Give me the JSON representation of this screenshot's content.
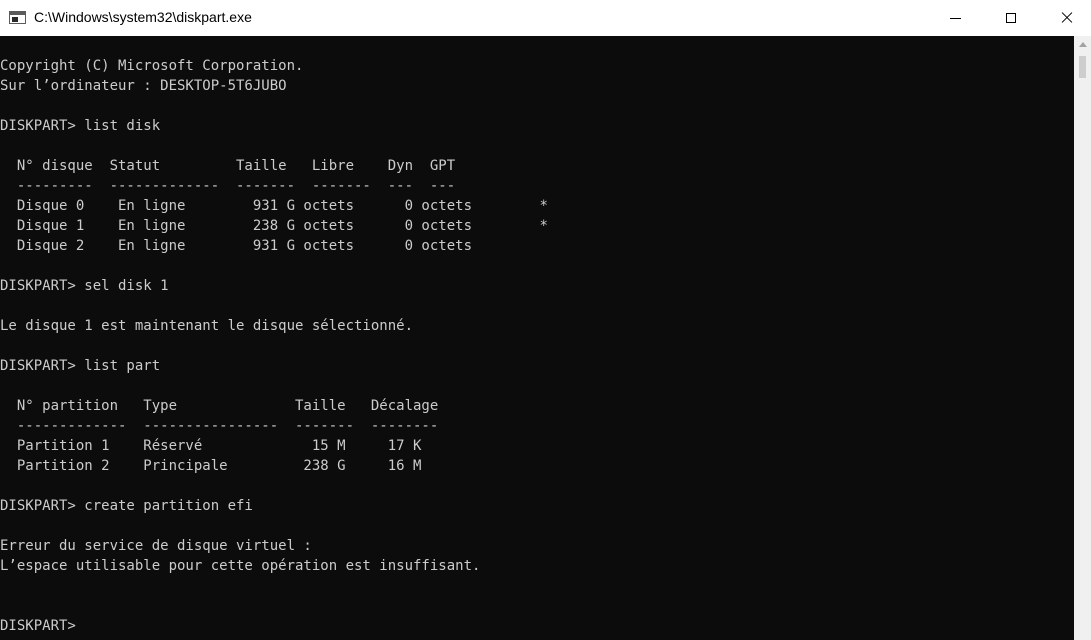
{
  "window": {
    "title": "C:\\Windows\\system32\\diskpart.exe",
    "icon": "console-app-icon",
    "controls": [
      "minimize",
      "maximize",
      "close"
    ]
  },
  "console": {
    "lines": [
      "Copyright (C) Microsoft Corporation.",
      "Sur l’ordinateur : DESKTOP-5T6JUBO",
      "",
      "DISKPART> list disk",
      "",
      "  N° disque  Statut         Taille   Libre    Dyn  GPT",
      "  ---------  -------------  -------  -------  ---  ---",
      "  Disque 0    En ligne        931 G octets      0 octets        *",
      "  Disque 1    En ligne        238 G octets      0 octets        *",
      "  Disque 2    En ligne        931 G octets      0 octets",
      "",
      "DISKPART> sel disk 1",
      "",
      "Le disque 1 est maintenant le disque sélectionné.",
      "",
      "DISKPART> list part",
      "",
      "  N° partition   Type              Taille   Décalage",
      "  -------------  ----------------  -------  --------",
      "  Partition 1    Réservé             15 M     17 K",
      "  Partition 2    Principale         238 G     16 M",
      "",
      "DISKPART> create partition efi",
      "",
      "Erreur du service de disque virtuel :",
      "L’espace utilisable pour cette opération est insuffisant.",
      "",
      "",
      "DISKPART> "
    ]
  },
  "colors": {
    "console_bg": "#0c0c0c",
    "console_text": "#cccccc",
    "titlebar_bg": "#ffffff"
  }
}
